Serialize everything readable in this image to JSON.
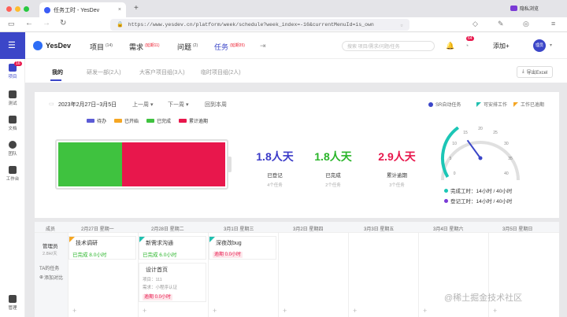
{
  "browser": {
    "tab_title": "任务工时 - YesDev",
    "new_tab": "+",
    "url": "https://www.yesdev.cn/platform/week/schedule?week_index=-16&currentMenuId=is_own",
    "private_label": "隐私浏览"
  },
  "app": {
    "logo": "YesDev",
    "nav": [
      {
        "label": "项目",
        "count": "(14)"
      },
      {
        "label": "需求",
        "count": "(延期11)"
      },
      {
        "label": "问题",
        "count": "(2)"
      },
      {
        "label": "任务",
        "count": "(延期35)"
      }
    ],
    "search_placeholder": "搜索 项目/需求/问题/任务",
    "badge_count": "64",
    "add_label": "添加+",
    "user": "理员"
  },
  "sidebar": [
    {
      "label": "项目",
      "badge": "16"
    },
    {
      "label": "测试"
    },
    {
      "label": "文档"
    },
    {
      "label": "团队"
    },
    {
      "label": "工作台"
    },
    {
      "label": "管理"
    }
  ],
  "subtabs": [
    "我的",
    "研发一部(2人)",
    "大客户项目组(3人)",
    "临时项目组(2人)"
  ],
  "export_label": "导出Excel",
  "toolbar": {
    "date_range": "2023年2月27日~3月5日",
    "prev": "上一周",
    "next": "下一周",
    "current": "回到本周",
    "auto": "SR自动任务",
    "todo_work": "可安排工作",
    "work_delayed": "工作已逾期"
  },
  "legend": [
    {
      "label": "待办",
      "color": "#5b5bd6"
    },
    {
      "label": "已开始",
      "color": "#f5a623"
    },
    {
      "label": "已完成",
      "color": "#3fc23f"
    },
    {
      "label": "累计逾期",
      "color": "#e8174c"
    }
  ],
  "bar": {
    "done_fraction": 0.38,
    "overdue_fraction": 0.62,
    "colors": {
      "done": "#3fc23f",
      "overdue": "#e8174c"
    }
  },
  "stats": [
    {
      "value": "1.8人天",
      "label": "已登记",
      "sub": "4个任务",
      "color": "#3b3bc8"
    },
    {
      "value": "1.8人天",
      "label": "已完成",
      "sub": "2个任务",
      "color": "#2ab52a"
    },
    {
      "value": "2.9人天",
      "label": "累计逾期",
      "sub": "3个任务",
      "color": "#e8174c"
    }
  ],
  "gauge": {
    "ticks": [
      "0",
      "5",
      "10",
      "15",
      "20",
      "25",
      "30",
      "35",
      "40"
    ],
    "max": 40,
    "value": 14,
    "done_text": "完成工时：14小时 / 40小时",
    "reg_text": "登记工时：14小时 / 40小时"
  },
  "grid": {
    "member_header": "成员",
    "days": [
      "2月27日 星期一",
      "2月28日 星期二",
      "3月1日 星期三",
      "3月2日 星期四",
      "3月3日 星期五",
      "3月4日 星期六",
      "3月5日 星期日"
    ],
    "member_name": "管理员",
    "member_rate": "2.8H/天",
    "ta_tasks": "TA的任务",
    "add_compare": "添加对比",
    "cards": {
      "c1": {
        "title": "技术调研",
        "status": "已完成 8.0小时"
      },
      "c2": {
        "title": "新需求沟通",
        "status": "已完成 6.0小时"
      },
      "c3": {
        "title": "深夜改bug",
        "status": "逾期 0.0小时"
      },
      "c4": {
        "title": "设计首页",
        "line1": "项目：111",
        "line2": "需求：小程序认证",
        "status": "逾期 0.0小时"
      }
    }
  },
  "watermark": "@稀土掘金技术社区"
}
